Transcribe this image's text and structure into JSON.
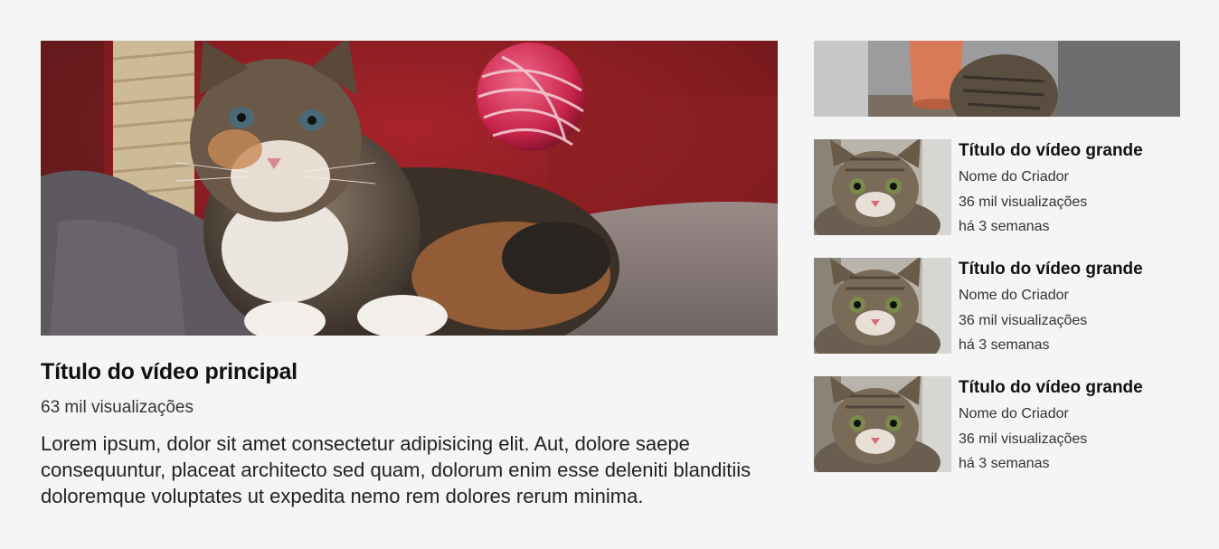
{
  "main": {
    "title": "Título do vídeo principal",
    "views": "63 mil visualizações",
    "description": "Lorem ipsum, dolor sit amet consectetur adipisicing elit. Aut, dolore saepe consequuntur, placeat architecto sed quam, dolorum enim esse deleniti blanditiis doloremque voluptates ut expedita nemo rem dolores rerum minima."
  },
  "sidebar": {
    "items": [
      {
        "title": "Título do vídeo grande",
        "creator": "Nome do Criador",
        "views": "36 mil visualizações",
        "date": "há 3 semanas"
      },
      {
        "title": "Título do vídeo grande",
        "creator": "Nome do Criador",
        "views": "36 mil visualizações",
        "date": "há 3 semanas"
      },
      {
        "title": "Título do vídeo grande",
        "creator": "Nome do Criador",
        "views": "36 mil visualizações",
        "date": "há 3 semanas"
      }
    ]
  }
}
